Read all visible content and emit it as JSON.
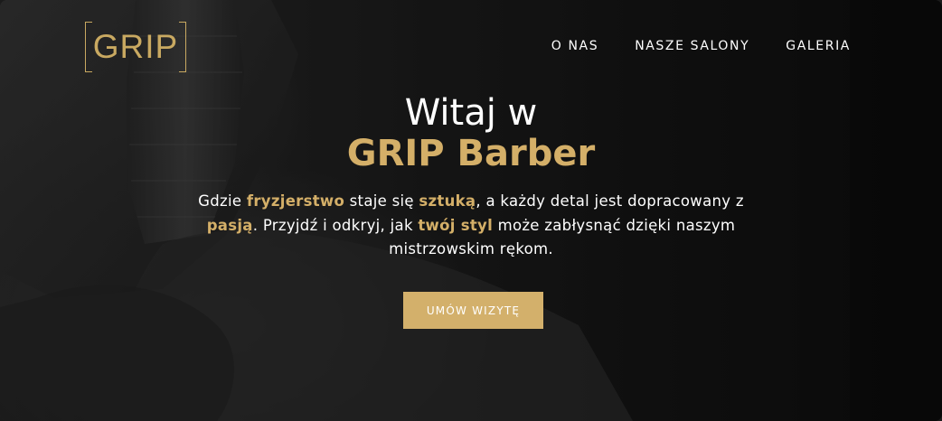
{
  "brand": {
    "logo_text": "GRIP"
  },
  "nav": {
    "items": [
      {
        "label": "O NAS"
      },
      {
        "label": "NASZE SALONY"
      },
      {
        "label": "GALERIA"
      }
    ]
  },
  "hero": {
    "title_line1": "Witaj w",
    "title_line2": "GRIP Barber",
    "description": {
      "t1": "Gdzie ",
      "h1": "fryzjerstwo",
      "t2": " staje się ",
      "h2": "sztuką",
      "t3": ", a każdy detal jest dopracowany z ",
      "h3": "pasją",
      "t4": ". Przyjdź i odkryj, jak ",
      "h4": "twój styl",
      "t5": " może zabłysnąć dzięki naszym mistrzowskim rękom."
    },
    "cta_label": "UMÓW WIZYTĘ"
  },
  "colors": {
    "accent": "#d3b06b",
    "background": "#1b1b1b",
    "text": "#ffffff"
  }
}
